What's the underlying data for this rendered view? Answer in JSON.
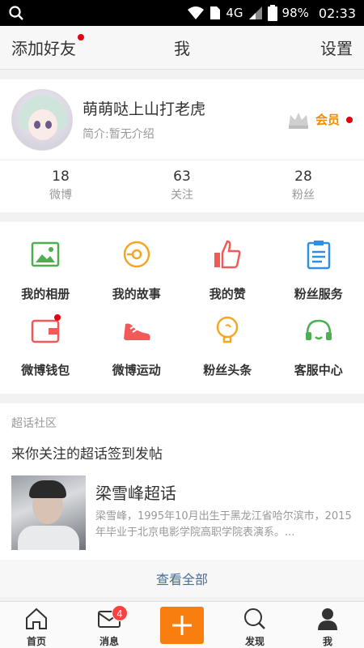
{
  "status_bar": {
    "network": "4G",
    "battery": "98%",
    "time": "02:33"
  },
  "header": {
    "left": "添加好友",
    "title": "我",
    "right": "设置"
  },
  "profile": {
    "name": "萌萌哒上山打老虎",
    "bio": "简介:暂无介绍",
    "member_label": "会员"
  },
  "stats": [
    {
      "num": "18",
      "label": "微博"
    },
    {
      "num": "63",
      "label": "关注"
    },
    {
      "num": "28",
      "label": "粉丝"
    }
  ],
  "grid": [
    {
      "label": "我的相册",
      "icon": "photo-album-icon",
      "color": "#4caf50"
    },
    {
      "label": "我的故事",
      "icon": "story-icon",
      "color": "#f5a623"
    },
    {
      "label": "我的赞",
      "icon": "thumbs-up-icon",
      "color": "#f25a5a"
    },
    {
      "label": "粉丝服务",
      "icon": "clipboard-icon",
      "color": "#2f8fe5"
    },
    {
      "label": "微博钱包",
      "icon": "wallet-icon",
      "color": "#f25a5a"
    },
    {
      "label": "微博运动",
      "icon": "sneaker-icon",
      "color": "#f25a5a"
    },
    {
      "label": "粉丝头条",
      "icon": "lightbulb-icon",
      "color": "#f5a623"
    },
    {
      "label": "客服中心",
      "icon": "headset-icon",
      "color": "#4caf50"
    }
  ],
  "super_topic": {
    "section_label": "超话社区",
    "subtitle": "来你关注的超话签到发帖",
    "title": "梁雪峰超话",
    "desc": "梁雪峰，1995年10月出生于黑龙江省哈尔滨市，2015年毕业于北京电影学院高职学院表演系。...",
    "view_all": "查看全部"
  },
  "tabs": [
    {
      "label": "首页",
      "icon": "home-icon"
    },
    {
      "label": "消息",
      "icon": "message-icon",
      "badge": "4"
    },
    {
      "label": "",
      "icon": "plus-icon"
    },
    {
      "label": "发现",
      "icon": "search-icon"
    },
    {
      "label": "我",
      "icon": "profile-icon"
    }
  ],
  "colors": {
    "accent": "#f87f0f",
    "member": "#f28b00",
    "link": "#4a6b9c",
    "red_dot": "#e60012"
  }
}
